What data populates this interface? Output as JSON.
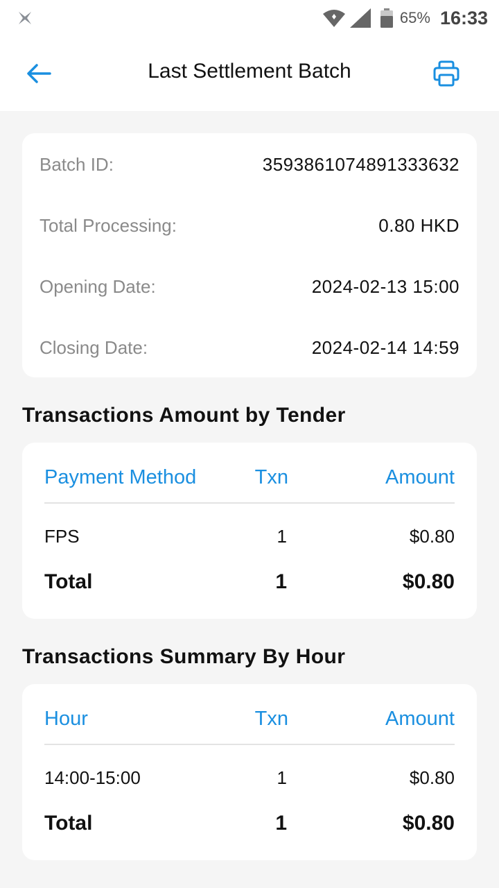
{
  "status_bar": {
    "battery_percent": "65%",
    "time": "16:33",
    "icons": [
      "app-icon",
      "wifi-icon",
      "signal-icon",
      "battery-icon"
    ]
  },
  "app_bar": {
    "title": "Last Settlement Batch",
    "back_icon": "arrow-left-icon",
    "print_icon": "printer-icon",
    "accent_color": "#1a8fe0"
  },
  "batch": {
    "rows": [
      {
        "label": "Batch ID:",
        "value": "3593861074891333632"
      },
      {
        "label": "Total Processing:",
        "value": "0.80 HKD"
      },
      {
        "label": "Opening Date:",
        "value": "2024-02-13 15:00"
      },
      {
        "label": "Closing Date:",
        "value": "2024-02-14 14:59"
      }
    ]
  },
  "tender": {
    "title": "Transactions Amount by Tender",
    "headers": [
      "Payment Method",
      "Txn",
      "Amount"
    ],
    "rows": [
      {
        "method": "FPS",
        "txn": "1",
        "amount": "$0.80"
      }
    ],
    "total": {
      "label": "Total",
      "txn": "1",
      "amount": "$0.80"
    }
  },
  "hourly": {
    "title": "Transactions Summary By Hour",
    "headers": [
      "Hour",
      "Txn",
      "Amount"
    ],
    "rows": [
      {
        "hour": "14:00-15:00",
        "txn": "1",
        "amount": "$0.80"
      }
    ],
    "total": {
      "label": "Total",
      "txn": "1",
      "amount": "$0.80"
    }
  }
}
